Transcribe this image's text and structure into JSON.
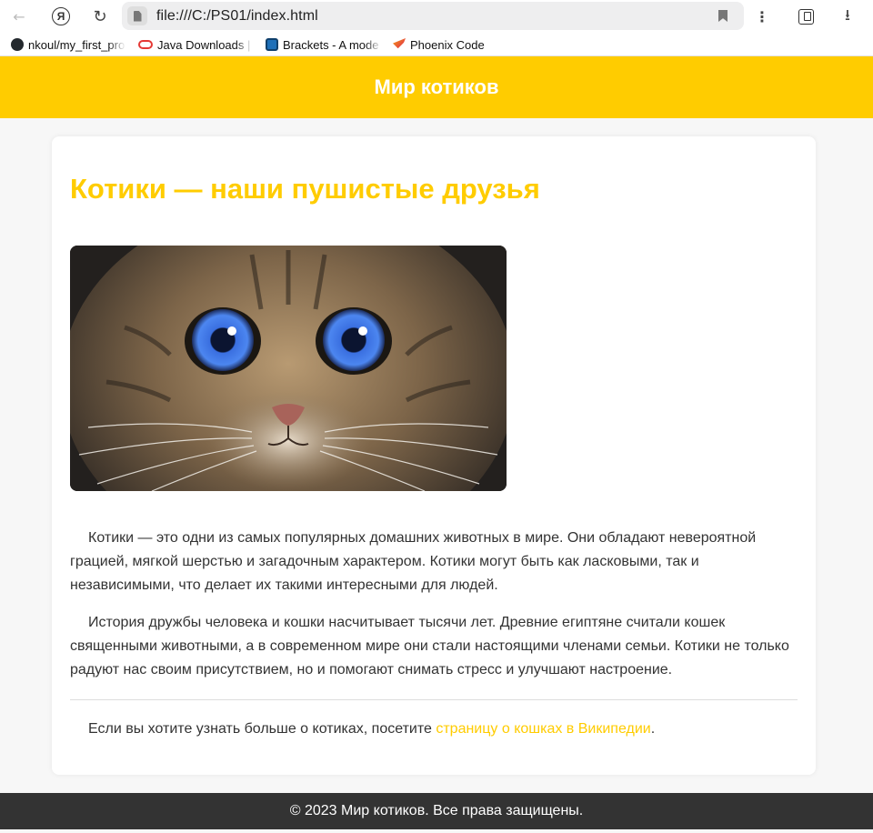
{
  "browser": {
    "url": "file:///C:/PS01/index.html",
    "bookmarks": [
      {
        "label": "nkoul/my_first_pro",
        "icon": "github-icon"
      },
      {
        "label": "Java Downloads | O",
        "icon": "oracle-icon"
      },
      {
        "label": "Brackets - A mode",
        "icon": "brackets-icon"
      },
      {
        "label": "Phoenix Code",
        "icon": "phoenix-icon"
      }
    ]
  },
  "header": {
    "title": "Мир котиков"
  },
  "main": {
    "heading": "Котики — наши пушистые друзья",
    "paragraph1": "Котики — это одни из самых популярных домашних животных в мире. Они обладают невероятной грацией, мягкой шерстью и загадочным характером. Котики могут быть как ласковыми, так и независимыми, что делает их такими интересными для людей.",
    "paragraph2": "История дружбы человека и кошки насчитывает тысячи лет. Древние египтяне считали кошек священными животными, а в современном мире они стали настоящими членами семьи. Котики не только радуют нас своим присутствием, но и помогают снимать стресс и улучшают настроение.",
    "more_prefix": "Если вы хотите узнать больше о котиках, посетите ",
    "more_link": "страницу о кошках в Википедии",
    "more_suffix": "."
  },
  "footer": {
    "text": "© 2023 Мир котиков. Все права защищены."
  },
  "colors": {
    "accent": "#ffcc00",
    "footer_bg": "#333333",
    "text": "#333333"
  }
}
